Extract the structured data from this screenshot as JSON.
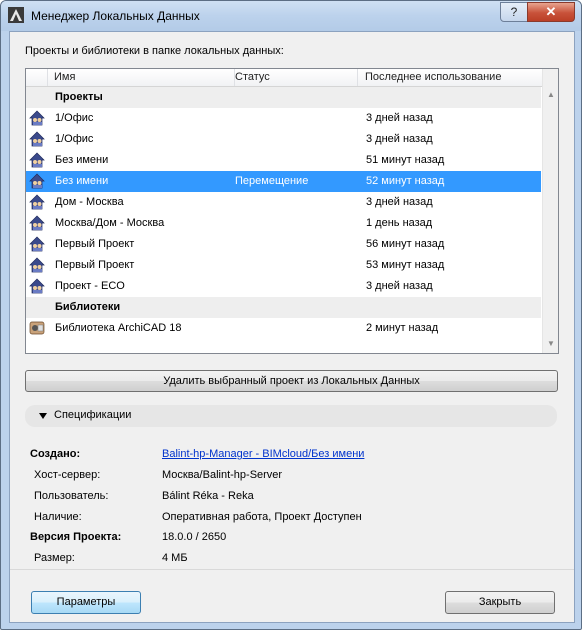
{
  "window": {
    "title": "Менеджер Локальных Данных",
    "help_label": "?",
    "close_label": "✕"
  },
  "intro_label": "Проекты и библиотеки в папке локальных данных:",
  "list": {
    "columns": [
      "Имя",
      "Статус",
      "Последнее использование"
    ],
    "rows": [
      {
        "type": "group",
        "name": "Проекты",
        "status": "",
        "last": ""
      },
      {
        "type": "item",
        "name": "1/Офис",
        "status": "",
        "last": "3 дней назад"
      },
      {
        "type": "item",
        "name": "1/Офис",
        "status": "",
        "last": "3 дней назад"
      },
      {
        "type": "item",
        "name": "Без имени",
        "status": "",
        "last": "51 минут назад"
      },
      {
        "type": "item",
        "name": "Без имени",
        "status": "Перемещение",
        "last": "52 минут назад",
        "selected": true
      },
      {
        "type": "item",
        "name": "Дом - Москва",
        "status": "",
        "last": "3 дней назад"
      },
      {
        "type": "item",
        "name": "Москва/Дом - Москва",
        "status": "",
        "last": "1 день назад"
      },
      {
        "type": "item",
        "name": "Первый Проект",
        "status": "",
        "last": "56 минут назад"
      },
      {
        "type": "item",
        "name": "Первый Проект",
        "status": "",
        "last": "53 минут назад"
      },
      {
        "type": "item",
        "name": "Проект - ECO",
        "status": "",
        "last": "3 дней назад"
      },
      {
        "type": "group",
        "name": "Библиотеки",
        "status": "",
        "last": ""
      },
      {
        "type": "lib",
        "name": "Библиотека ArchiCAD 18",
        "status": "",
        "last": "2 минут назад"
      }
    ]
  },
  "delete_button": "Удалить выбранный проект из Локальных Данных",
  "specs_toggle": "Спецификации",
  "details": {
    "created_label": "Создано:",
    "created_value": "Balint-hp-Manager - BIMcloud/Без имени",
    "host_label": "Хост-сервер:",
    "host_value": "Москва/Balint-hp-Server",
    "user_label": "Пользователь:",
    "user_value": "Bálint Réka - Reka",
    "availability_label": "Наличие:",
    "availability_value": "Оперативная работа, Проект Доступен",
    "version_label": "Версия Проекта:",
    "version_value": "18.0.0 / 2650",
    "size_label": "Размер:",
    "size_value": "4 МБ"
  },
  "buttons": {
    "settings": "Параметры",
    "close": "Закрыть"
  },
  "colors": {
    "selection": "#3399ff",
    "link": "#0033cc",
    "title_bar": "#bcd2ec"
  },
  "icons": {
    "app": "archicad-icon",
    "project": "teamwork-project-icon",
    "library": "library-icon",
    "specs_toggle": "triangle-down-icon"
  }
}
